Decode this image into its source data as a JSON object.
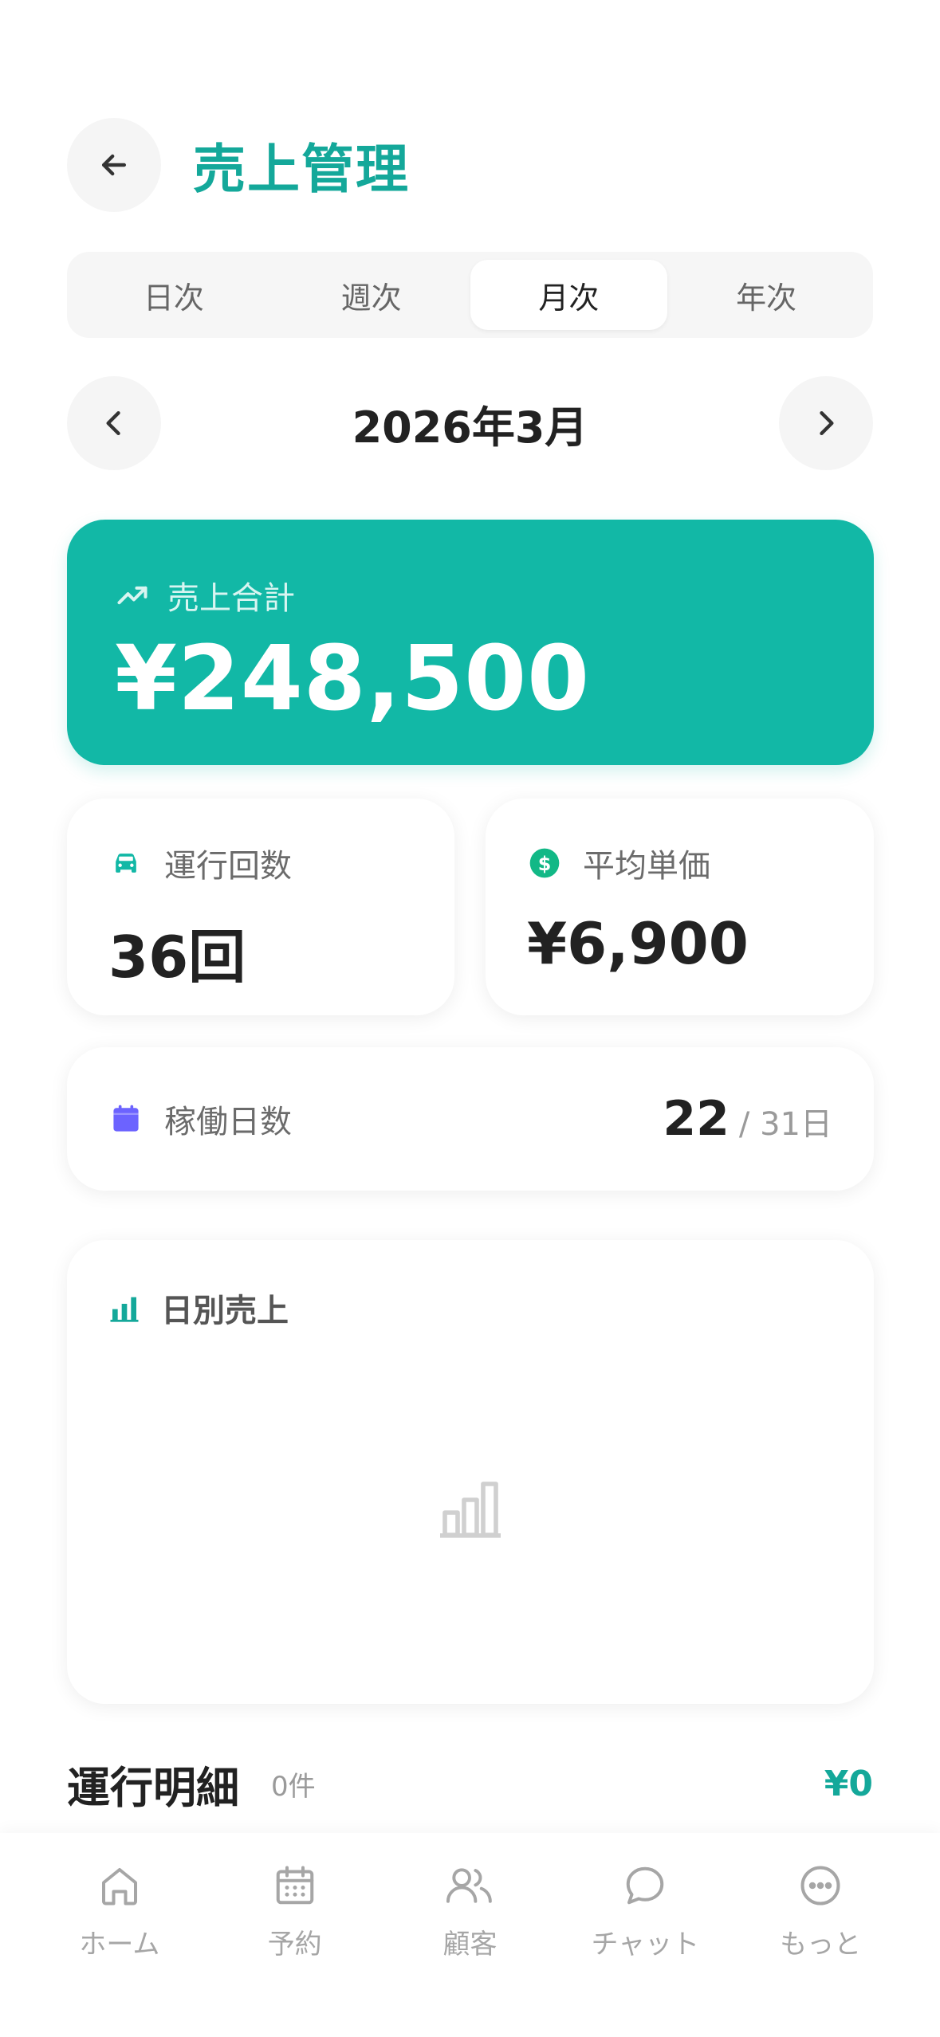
{
  "header": {
    "title": "売上管理",
    "back_icon": "arrow-left-icon"
  },
  "period_tabs": [
    {
      "label": "日次",
      "active": false
    },
    {
      "label": "週次",
      "active": false
    },
    {
      "label": "月次",
      "active": true
    },
    {
      "label": "年次",
      "active": false
    }
  ],
  "period": {
    "label": "2026年3月",
    "prev_icon": "chevron-left-icon",
    "next_icon": "chevron-right-icon"
  },
  "total": {
    "label": "売上合計",
    "value": "¥248,500",
    "icon": "trending-up-icon"
  },
  "stats": {
    "rides": {
      "label": "運行回数",
      "value": "36回",
      "icon": "car-icon"
    },
    "avg_price": {
      "label": "平均単価",
      "value": "¥6,900",
      "icon": "dollar-circle-icon"
    }
  },
  "working_days": {
    "label": "稼働日数",
    "value": "22",
    "total": "/ 31日",
    "icon": "calendar-icon"
  },
  "daily_sales": {
    "label": "日別売上",
    "icon": "bar-chart-icon",
    "empty_icon": "bar-chart-outline-icon"
  },
  "details": {
    "title": "運行明細",
    "count": "0件",
    "amount": "¥0"
  },
  "tabbar": [
    {
      "label": "ホーム",
      "icon": "home-icon"
    },
    {
      "label": "予約",
      "icon": "calendar-icon"
    },
    {
      "label": "顧客",
      "icon": "users-icon"
    },
    {
      "label": "チャット",
      "icon": "chat-icon"
    },
    {
      "label": "もっと",
      "icon": "more-icon"
    }
  ],
  "colors": {
    "brand": "#14a89a",
    "card_accent": "#12b8a6",
    "calendar": "#6c63ff",
    "dollar": "#12b886"
  }
}
